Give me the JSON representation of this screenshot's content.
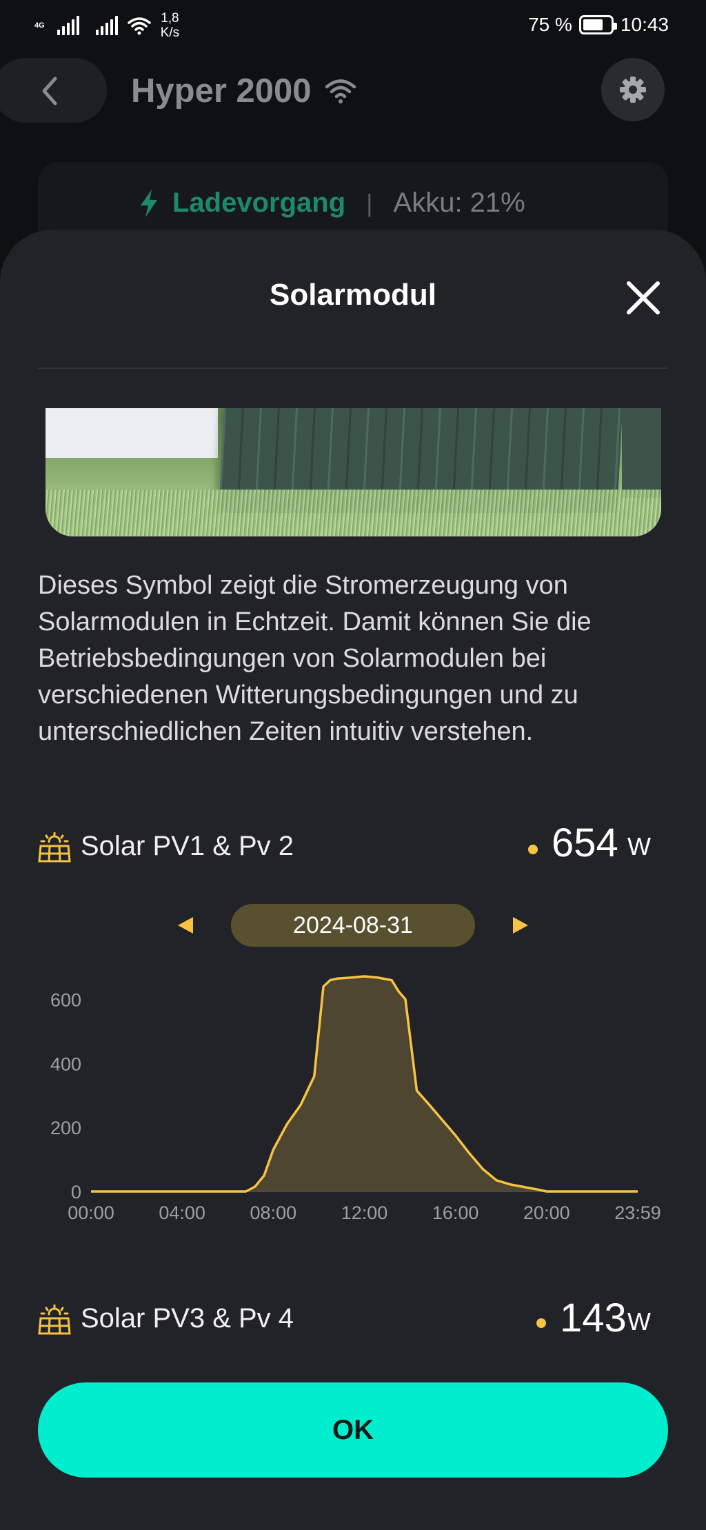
{
  "status_bar": {
    "network_tag": "4G",
    "speed_value": "1,8",
    "speed_unit": "K/s",
    "battery_percent": "75 %",
    "battery_level": 0.75,
    "time": "10:43"
  },
  "header": {
    "device_name": "Hyper 2000",
    "status_charging": "Ladevorgang",
    "status_separator": "|",
    "status_battery": "Akku: 21%"
  },
  "sheet": {
    "title": "Solarmodul",
    "description": "Dieses Symbol zeigt die Stromerzeugung von Solarmodulen in Echtzeit. Damit können Sie die Betriebsbedingungen von Solarmodulen bei verschiedenen Witterungsbedingungen und zu unterschiedlichen Zeiten intuitiv verstehen.",
    "pv12": {
      "label": "Solar PV1 & Pv 2",
      "value": "654",
      "unit": "W"
    },
    "pv34": {
      "label": "Solar PV3 & Pv 4",
      "value": "143",
      "unit": "W"
    },
    "date": "2024-08-31",
    "ok_label": "OK"
  },
  "colors": {
    "accent": "#00eecd",
    "solar_yellow": "#f6c343",
    "charging_green": "#1d8a6b",
    "sheet_bg": "#222328"
  },
  "chart_data": {
    "type": "area",
    "title": "",
    "xlabel": "",
    "ylabel": "",
    "x_ticks": [
      "00:00",
      "04:00",
      "08:00",
      "12:00",
      "16:00",
      "20:00",
      "23:59"
    ],
    "y_ticks": [
      "0",
      "200",
      "400",
      "600"
    ],
    "xlim": [
      0,
      24
    ],
    "ylim": [
      0,
      700
    ],
    "grid": false,
    "series": [
      {
        "x": [
          0,
          6.8,
          7.2,
          7.6,
          8.0,
          8.6,
          9.2,
          9.8,
          10.2,
          10.5,
          10.8,
          11.4,
          12.0,
          12.6,
          13.2,
          13.5,
          13.8,
          14.3,
          14.8,
          15.4,
          16.0,
          16.6,
          17.2,
          17.8,
          18.4,
          19.0,
          19.6,
          20.0,
          24.0
        ],
        "y": [
          0,
          0,
          15,
          50,
          130,
          210,
          270,
          360,
          640,
          660,
          665,
          668,
          672,
          668,
          660,
          625,
          600,
          315,
          275,
          225,
          175,
          120,
          70,
          35,
          22,
          14,
          6,
          0,
          0
        ]
      }
    ]
  }
}
